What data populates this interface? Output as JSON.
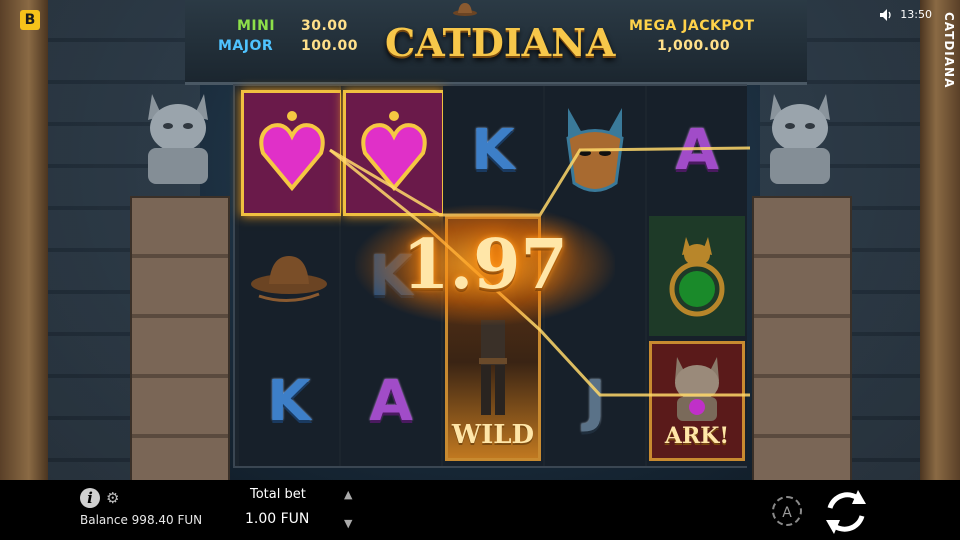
{
  "brand": {
    "badge": "B"
  },
  "status": {
    "time": "13:50",
    "vertical_title": "CATDIANA"
  },
  "jackpots": {
    "mini_label": "MINI",
    "mini_value": "30.00",
    "major_label": "MAJOR",
    "major_value": "100.00",
    "mega_label": "MEGA JACKPOT",
    "mega_value": "1,000.00"
  },
  "logo": {
    "text": "CATDIANA"
  },
  "reels": [
    [
      "gem-heart",
      "cowboy-hat-whip",
      "K"
    ],
    [
      "gem-heart",
      "K",
      "A"
    ],
    [
      "K",
      "wild-explorer",
      "wild-explorer"
    ],
    [
      "cat-mask",
      "hidden",
      "J"
    ],
    [
      "A",
      "cat-amulet",
      "ark-cat"
    ]
  ],
  "symbols": {
    "wild_label": "WILD",
    "ark_label": "ARK!",
    "k": "K",
    "a": "A",
    "j": "J"
  },
  "win": {
    "amount": "1.97"
  },
  "footer": {
    "balance": "Balance 998.40 FUN",
    "total_bet_label": "Total bet",
    "total_bet_value": "1.00 FUN",
    "auto_label": "A"
  },
  "colors": {
    "gold": "#f0c040",
    "win_glow": "#ff9a20",
    "k_blue": "#3d7fc8",
    "a_purple": "#a14cc8"
  }
}
